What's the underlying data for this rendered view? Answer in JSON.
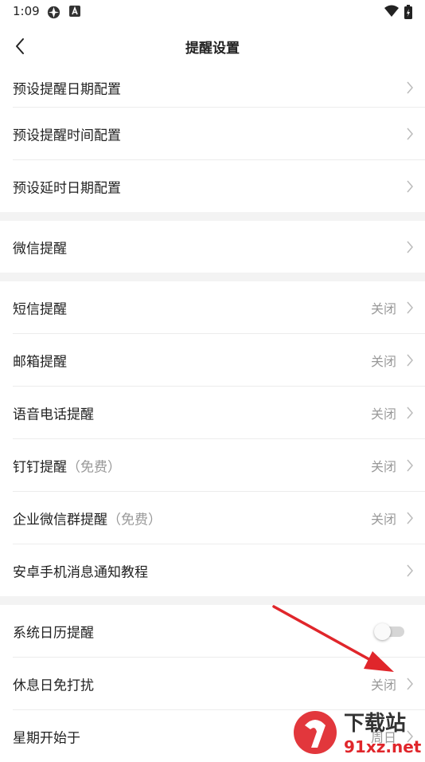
{
  "status_bar": {
    "time": "1:09"
  },
  "header": {
    "title": "提醒设置"
  },
  "groups": [
    {
      "rows": [
        {
          "label": "预设提醒日期配置"
        },
        {
          "label": "预设提醒时间配置"
        },
        {
          "label": "预设延时日期配置"
        }
      ]
    },
    {
      "rows": [
        {
          "label": "微信提醒"
        }
      ]
    },
    {
      "rows": [
        {
          "label": "短信提醒",
          "value": "关闭"
        },
        {
          "label": "邮箱提醒",
          "value": "关闭"
        },
        {
          "label": "语音电话提醒",
          "value": "关闭"
        },
        {
          "label": "钉钉提醒",
          "note": "（免费）",
          "value": "关闭"
        },
        {
          "label": "企业微信群提醒",
          "note": "（免费）",
          "value": "关闭"
        },
        {
          "label": "安卓手机消息通知教程"
        }
      ]
    },
    {
      "rows": [
        {
          "label": "系统日历提醒",
          "toggle": false
        },
        {
          "label": "休息日免打扰",
          "value": "关闭"
        },
        {
          "label": "星期开始于",
          "value": "周日"
        }
      ]
    }
  ],
  "watermark": {
    "brand": "下载站",
    "domain": "91xz.net"
  },
  "colors": {
    "accent_arrow": "#e0262b",
    "watermark": "#e0262b",
    "muted": "#999999"
  }
}
